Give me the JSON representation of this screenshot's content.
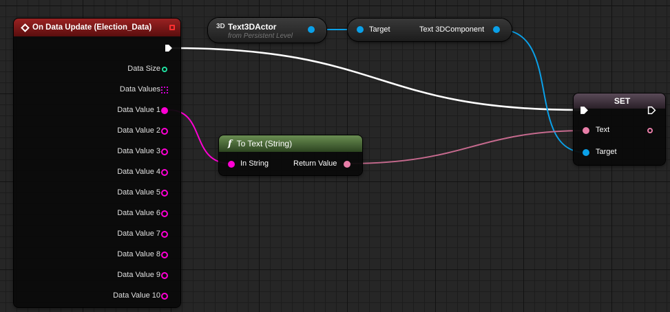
{
  "event_node": {
    "title": "On Data Update (Election_Data)",
    "header_color": "#8a1a1a",
    "pins": {
      "data_size": "Data Size",
      "data_values": "Data Values",
      "values": [
        "Data Value 1",
        "Data Value 2",
        "Data Value 3",
        "Data Value 4",
        "Data Value 5",
        "Data Value 6",
        "Data Value 7",
        "Data Value 8",
        "Data Value 9",
        "Data Value 10"
      ]
    }
  },
  "actor_node": {
    "badge": "3D",
    "title": "Text3DActor",
    "subtitle": "from Persistent Level"
  },
  "getter_node": {
    "input_label": "Target",
    "output_label": "Text 3DComponent"
  },
  "to_text_node": {
    "icon": "f",
    "title": "To Text (String)",
    "header_color": "#4f6e3c",
    "input_label": "In String",
    "output_label": "Return Value"
  },
  "set_node": {
    "title": "SET",
    "header_color": "#4a3a48",
    "text_label": "Text",
    "target_label": "Target"
  },
  "colors": {
    "exec": "#ffffff",
    "int_pin": "#1fe0a0",
    "string_pin": "#ff00d4",
    "text_pin": "#e87ea8",
    "object_pin": "#0aa0e8",
    "map_pin": "#d400d4"
  }
}
